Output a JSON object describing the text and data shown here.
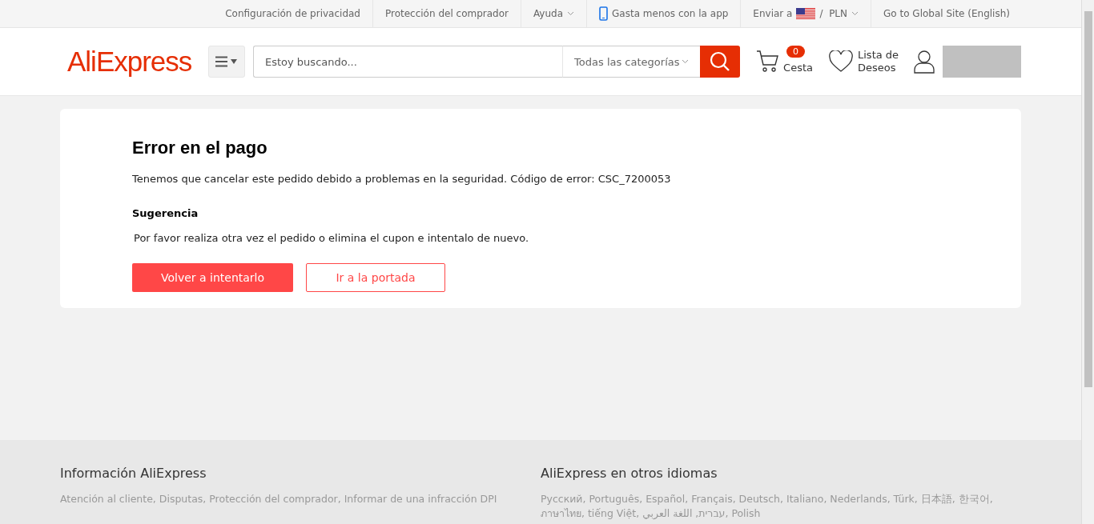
{
  "top_bar": {
    "links": [
      {
        "label": "Configuración de privacidad",
        "kind": "plain"
      },
      {
        "label": "Protección del comprador",
        "kind": "plain"
      },
      {
        "label": "Ayuda",
        "kind": "dropdown"
      },
      {
        "label": "Gasta menos con la app",
        "kind": "phone"
      },
      {
        "label": "Enviar a",
        "kind": "ship",
        "currency": "PLN",
        "separator": "/"
      },
      {
        "label": "Go to Global Site (English)",
        "kind": "plain"
      }
    ]
  },
  "header": {
    "logo": "AliExpress",
    "search": {
      "placeholder": "Estoy buscando...",
      "category": "Todas las categorías"
    },
    "cart": {
      "count": "0",
      "label": "Cesta"
    },
    "wishlist": "Lista de Deseos"
  },
  "error_card": {
    "title": "Error en el pago",
    "message": "Tenemos que cancelar este pedido debido a problemas en la seguridad. Código de error: CSC_7200053",
    "suggestion_title": "Sugerencia",
    "suggestion": "Por favor realiza otra vez el pedido o elimina el cupon e intentalo de nuevo.",
    "buttons": [
      {
        "label": "Volver a intentarlo",
        "kind": "primary"
      },
      {
        "label": "Ir a la portada",
        "kind": "secondary"
      }
    ]
  },
  "footer": {
    "columns": [
      {
        "title": "Información AliExpress",
        "text": "Atención al cliente, Disputas, Protección del comprador, Informar de una infracción DPI"
      },
      {
        "title": "AliExpress en otros idiomas",
        "text": "Русский, Português, Español, Français, Deutsch, Italiano, Nederlands, Türk, 日本語, 한국어, ภาษาไทย, tiếng Việt, עברית, اللغة العربي, Polish"
      }
    ]
  }
}
